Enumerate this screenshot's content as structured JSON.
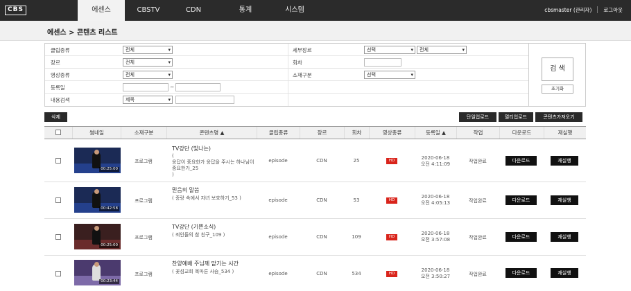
{
  "app": {
    "logo": "CBS"
  },
  "nav": [
    {
      "label": "에센스",
      "active": true
    },
    {
      "label": "CBSTV",
      "active": false
    },
    {
      "label": "CDN",
      "active": false
    },
    {
      "label": "통계",
      "active": false
    },
    {
      "label": "시스템",
      "active": false
    }
  ],
  "user": {
    "name": "cbsmaster (관리자)",
    "logout": "로그아웃"
  },
  "breadcrumb": "에센스 > 콘텐츠 리스트",
  "form": {
    "clip_type": {
      "label": "클립종류",
      "value": "전체"
    },
    "genre": {
      "label": "장르",
      "value": "전체"
    },
    "video_type": {
      "label": "영상종류",
      "value": "전체"
    },
    "reg_date": {
      "label": "등록일",
      "tilde": "~"
    },
    "content_search": {
      "label": "내용검색",
      "value": "제목"
    },
    "sub_genre": {
      "label": "세부장르",
      "value1": "선택",
      "value2": "전체"
    },
    "episode": {
      "label": "회차"
    },
    "material": {
      "label": "소재구분",
      "value": "선택"
    },
    "search_button": "검 색",
    "reset_button": "초기화"
  },
  "actions": {
    "delete": "삭제",
    "single_upload": "단일업로드",
    "multi_upload": "멀티업로드",
    "import_content": "콘텐츠가져오기"
  },
  "table": {
    "headers": [
      "",
      "썸네일",
      "소재구분",
      "콘텐츠명 ▲",
      "클립종류",
      "장르",
      "회차",
      "영상종류",
      "등록일 ▲",
      "작업",
      "다운로드",
      "재실행"
    ],
    "rows": [
      {
        "duration": "00:25:00",
        "material": "프로그램",
        "title": "TV강단 (빛나는)",
        "subtitle": "(\n응답이 중요한가 응답을 주시는 하나님이 중요한가_25\n)",
        "clip": "episode",
        "genre": "CDN",
        "episode": "25",
        "video": "HD",
        "date": "2020-06-18",
        "time": "오전 4:11:09",
        "status": "작업완료",
        "download": "다운로드",
        "rerun": "재실행"
      },
      {
        "duration": "00:42:58",
        "material": "프로그램",
        "title": "믿음의 말씀",
        "subtitle": "( 증랑 속에서 자녀 보호하기_53 )",
        "clip": "episode",
        "genre": "CDN",
        "episode": "53",
        "video": "HD",
        "date": "2020-06-18",
        "time": "오전 4:05:13",
        "status": "작업완료",
        "download": "다운로드",
        "rerun": "재실행"
      },
      {
        "duration": "00:25:00",
        "material": "프로그램",
        "title": "TV강단 (기쁜소식)",
        "subtitle": "( 죄인들의 참 친구_109 )",
        "clip": "episode",
        "genre": "CDN",
        "episode": "109",
        "video": "HD",
        "date": "2020-06-18",
        "time": "오전 3:57:08",
        "status": "작업완료",
        "download": "다운로드",
        "rerun": "재실행"
      },
      {
        "duration": "00:23:44",
        "material": "프로그램",
        "title": "찬양예배 주님께 맡기는 시간",
        "subtitle": "( 꽃섬교회 목마른 사슴_534 )",
        "clip": "episode",
        "genre": "CDN",
        "episode": "534",
        "video": "HD",
        "date": "2020-06-18",
        "time": "오전 3:50:27",
        "status": "작업완료",
        "download": "다운로드",
        "rerun": "재실행"
      }
    ]
  },
  "colors": {
    "topbar": "#2b2b2b",
    "hd_badge": "#d9241b",
    "button": "#111111"
  }
}
